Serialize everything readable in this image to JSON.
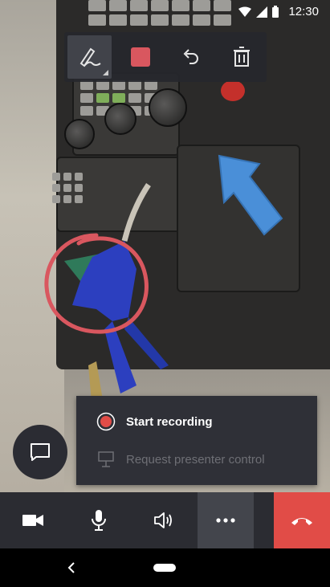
{
  "status_bar": {
    "time": "12:30"
  },
  "ink_toolbar": {
    "tools": [
      {
        "name": "pen",
        "icon": "pen-icon",
        "active": true
      },
      {
        "name": "color",
        "icon": "color-swatch",
        "color": "#d9575f"
      },
      {
        "name": "undo",
        "icon": "undo-icon"
      },
      {
        "name": "delete",
        "icon": "trash-icon"
      }
    ]
  },
  "menu": {
    "items": [
      {
        "label": "Start recording",
        "icon": "record-icon",
        "enabled": true,
        "icon_color": "#e14c47"
      },
      {
        "label": "Request presenter control",
        "icon": "presenter-icon",
        "enabled": false
      }
    ]
  },
  "call_controls": {
    "buttons": [
      {
        "name": "video",
        "icon": "video-camera-icon"
      },
      {
        "name": "mic",
        "icon": "microphone-icon"
      },
      {
        "name": "speaker",
        "icon": "speaker-icon"
      },
      {
        "name": "more",
        "icon": "more-options-icon"
      },
      {
        "name": "hang-up",
        "icon": "phone-hangup-icon",
        "color": "#e14c47"
      }
    ]
  },
  "colors": {
    "annotation_red": "#d9575f",
    "annotation_blue": "#4a8fd8",
    "hangup": "#e14c47",
    "panel_bg": "#2f3037"
  }
}
